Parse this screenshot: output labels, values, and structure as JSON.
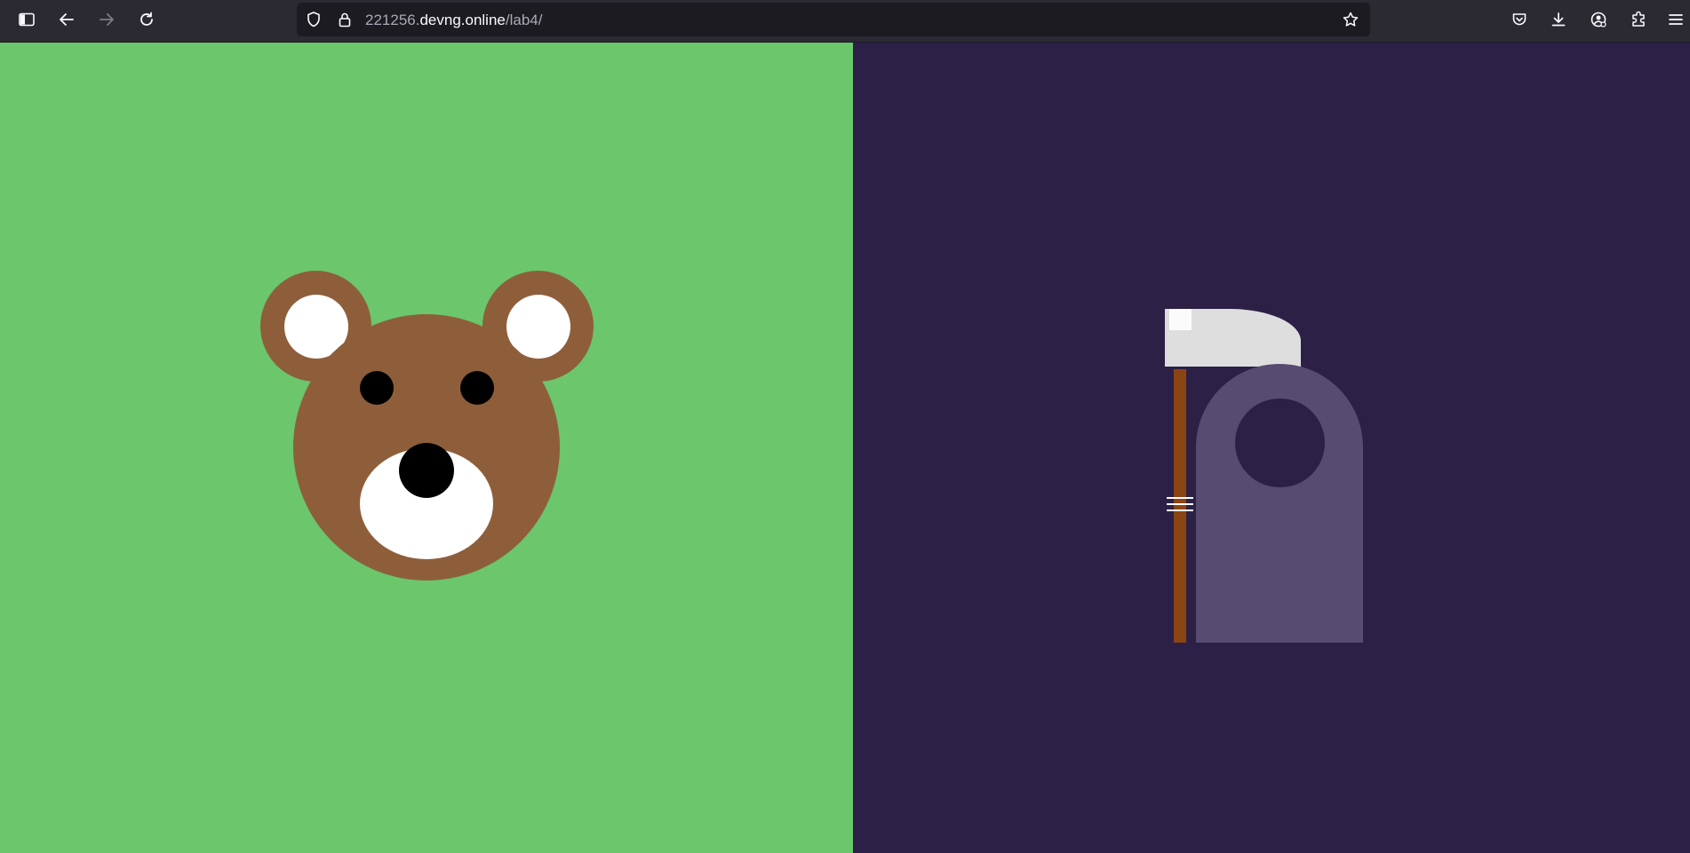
{
  "browser": {
    "url": {
      "subdomain": "221256.",
      "domain": "devng.online",
      "path": "/lab4/"
    },
    "icons": {
      "sidebar": "sidebar-icon",
      "back": "back-arrow-icon",
      "forward": "forward-arrow-icon",
      "reload": "reload-icon",
      "tracking": "shield-icon",
      "security": "lock-icon",
      "bookmark": "star-icon",
      "pocket": "pocket-icon",
      "downloads": "download-icon",
      "account": "account-icon",
      "extensions": "extensions-icon",
      "menu": "hamburger-menu-icon"
    }
  },
  "page": {
    "left_panel": {
      "background": "#6bc66c",
      "illustration": "bear-face"
    },
    "right_panel": {
      "background": "#2c2046",
      "illustration": "grim-reaper-with-scythe"
    },
    "colors": {
      "bear_fur": "#8e5e3b",
      "bear_white": "#ffffff",
      "bear_black": "#000000",
      "cloak": "#574b71",
      "blade": "#dedede",
      "handle": "#8b4513"
    }
  }
}
